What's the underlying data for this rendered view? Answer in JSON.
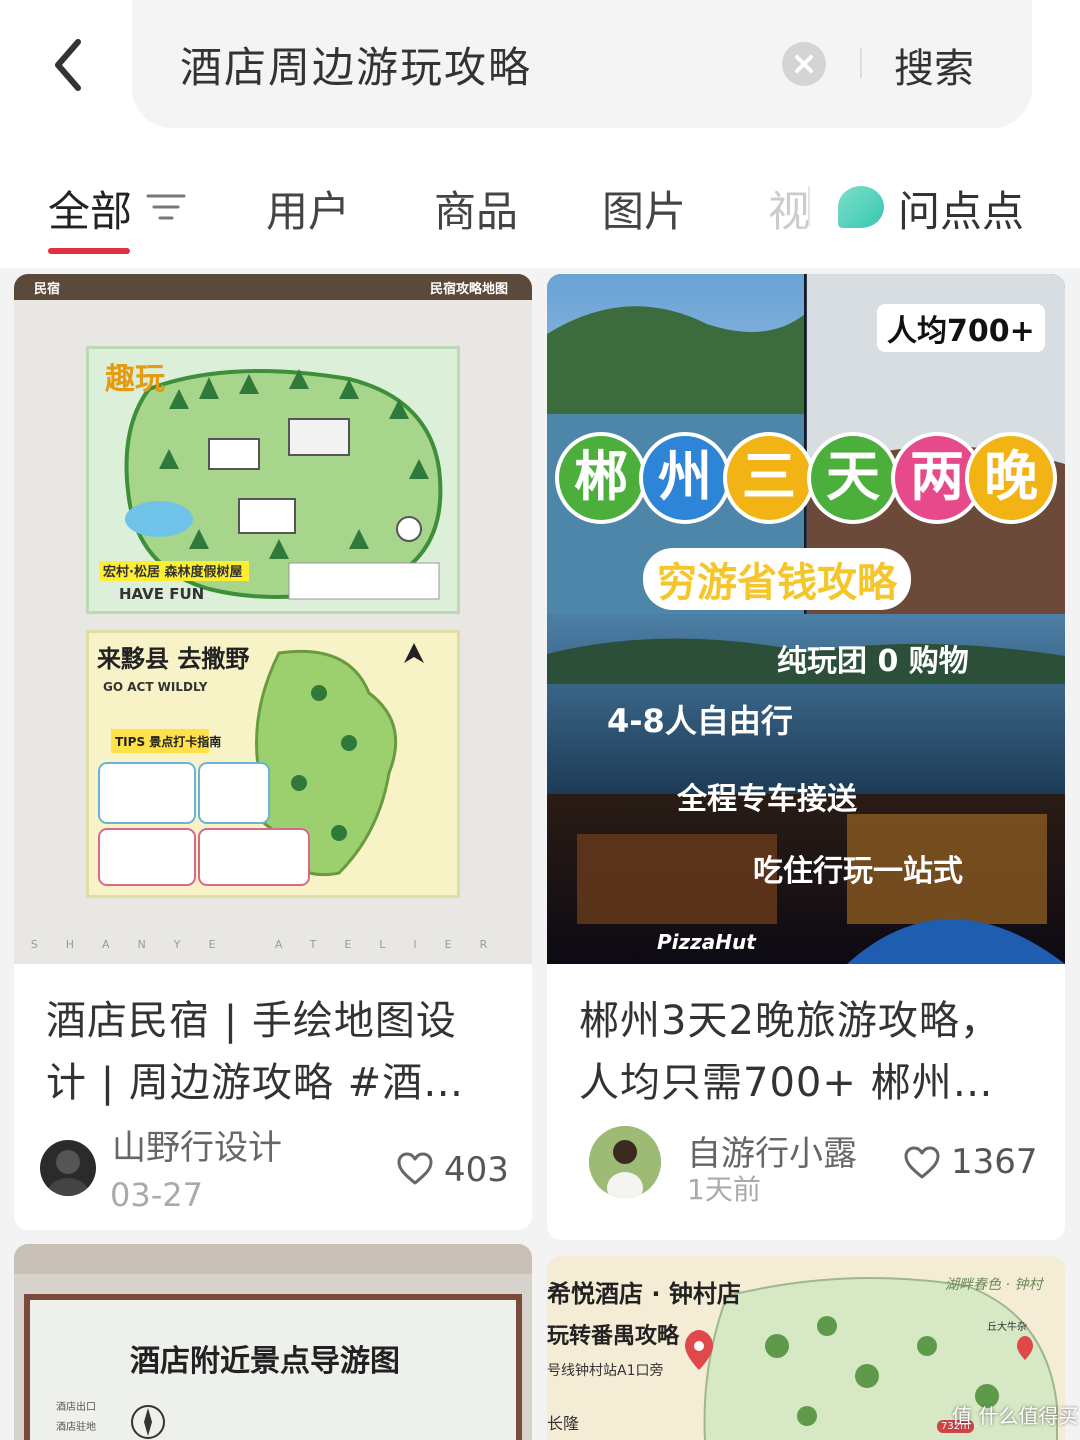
{
  "search": {
    "query": "酒店周边游玩攻略",
    "button_label": "搜索"
  },
  "tabs": {
    "items": [
      {
        "label": "全部"
      },
      {
        "label": "用户"
      },
      {
        "label": "商品"
      },
      {
        "label": "图片"
      }
    ],
    "partial_label": "视",
    "feature_label": "问点点"
  },
  "cards": [
    {
      "cover": {
        "strip_left": "民宿",
        "strip_right": "民宿攻略地图",
        "map1_title": "趣玩",
        "map1_sub": "宏村·松居 森林度假树屋",
        "map1_tag": "HAVE FUN",
        "map2_title": "来黟县 去撒野",
        "map2_sub": "GO ACT WILDLY",
        "map2_tips": "TIPS 景点打卡指南",
        "watermark": "SHANYE ATELIER"
      },
      "title_lines": [
        "酒店民宿 | 手绘地图设",
        "计 | 周边游攻略 #酒…"
      ],
      "author": "山野行设计",
      "date": "03-27",
      "likes": "403"
    },
    {
      "cover": {
        "price_tag": "人均700+",
        "title_chars": [
          "郴",
          "州",
          "三",
          "天",
          "两",
          "晚"
        ],
        "subtitle": "穷游省钱攻略",
        "tag1": "纯玩团 0 购物",
        "tag2": "4-8人自由行",
        "tag3": "全程专车接送",
        "tag4": "吃住行玩一站式",
        "brand": "PizzaHut"
      },
      "title_lines": [
        "郴州3天2晚旅游攻略，",
        "人均只需700+ 郴州…"
      ],
      "author": "自游行小露",
      "date": "1天前",
      "likes": "1367"
    },
    {
      "cover": {
        "heading": "酒店附近景点导游图",
        "legend1": "酒店出口",
        "legend2": "酒店驻地"
      }
    },
    {
      "cover": {
        "line1": "希悦酒店 · 钟村店",
        "line2": "玩转番禺攻略",
        "line3": "号线钟村站A1口旁",
        "line4": "长隆",
        "top_right": "湖畔春色 · 钟村",
        "label_a": "丘大牛杂",
        "label_b": "732m"
      }
    }
  ],
  "watermark": "值 什么值得买",
  "colors": {
    "accent": "#e03040",
    "bubble_green": "#4caf3c",
    "bubble_blue": "#2e84d6",
    "bubble_yellow": "#f2b314",
    "bubble_red": "#e64a8a"
  }
}
